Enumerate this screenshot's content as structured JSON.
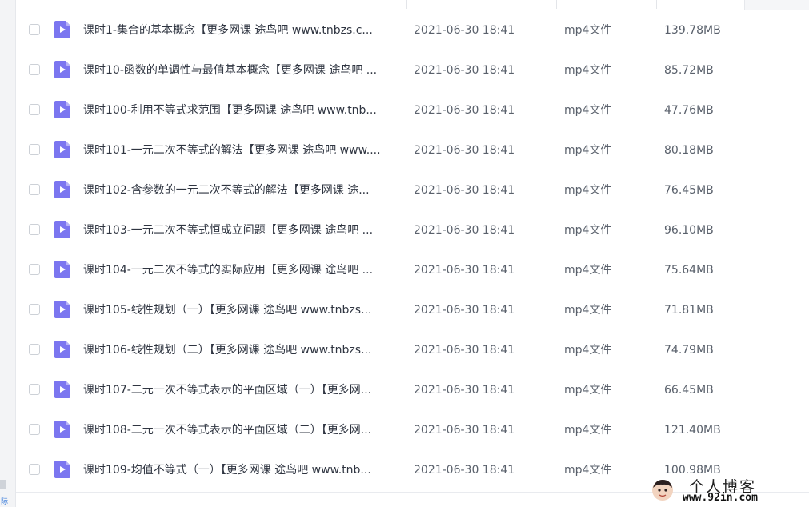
{
  "header": {
    "name_col": "",
    "date_col": "",
    "type_col": "",
    "size_col": ""
  },
  "colors": {
    "icon_bg": "#7b76f0",
    "icon_fold": "#b7b3f8",
    "side_glyph": "#3b7ddb"
  },
  "left_panel": {
    "edge_glyph": "际"
  },
  "files": [
    {
      "name": "课时1-集合的基本概念【更多网课 途鸟吧 www.tnbzs.c...",
      "date": "2021-06-30 18:41",
      "type": "mp4文件",
      "size": "139.78MB",
      "icon": "video-file-icon"
    },
    {
      "name": "课时10-函数的单调性与最值基本概念【更多网课 途鸟吧 ...",
      "date": "2021-06-30 18:41",
      "type": "mp4文件",
      "size": "85.72MB",
      "icon": "video-file-icon"
    },
    {
      "name": "课时100-利用不等式求范围【更多网课 途鸟吧 www.tnb...",
      "date": "2021-06-30 18:41",
      "type": "mp4文件",
      "size": "47.76MB",
      "icon": "video-file-icon"
    },
    {
      "name": "课时101-一元二次不等式的解法【更多网课 途鸟吧 www....",
      "date": "2021-06-30 18:41",
      "type": "mp4文件",
      "size": "80.18MB",
      "icon": "video-file-icon"
    },
    {
      "name": "课时102-含参数的一元二次不等式的解法【更多网课 途...",
      "date": "2021-06-30 18:41",
      "type": "mp4文件",
      "size": "76.45MB",
      "icon": "video-file-icon"
    },
    {
      "name": "课时103-一元二次不等式恒成立问题【更多网课 途鸟吧 ...",
      "date": "2021-06-30 18:41",
      "type": "mp4文件",
      "size": "96.10MB",
      "icon": "video-file-icon"
    },
    {
      "name": "课时104-一元二次不等式的实际应用【更多网课 途鸟吧 ...",
      "date": "2021-06-30 18:41",
      "type": "mp4文件",
      "size": "75.64MB",
      "icon": "video-file-icon"
    },
    {
      "name": "课时105-线性规划（一）【更多网课 途鸟吧 www.tnbzs...",
      "date": "2021-06-30 18:41",
      "type": "mp4文件",
      "size": "71.81MB",
      "icon": "video-file-icon"
    },
    {
      "name": "课时106-线性规划（二）【更多网课 途鸟吧 www.tnbzs...",
      "date": "2021-06-30 18:41",
      "type": "mp4文件",
      "size": "74.79MB",
      "icon": "video-file-icon"
    },
    {
      "name": "课时107-二元一次不等式表示的平面区域（一）【更多网...",
      "date": "2021-06-30 18:41",
      "type": "mp4文件",
      "size": "66.45MB",
      "icon": "video-file-icon"
    },
    {
      "name": "课时108-二元一次不等式表示的平面区域（二）【更多网...",
      "date": "2021-06-30 18:41",
      "type": "mp4文件",
      "size": "121.40MB",
      "icon": "video-file-icon"
    },
    {
      "name": "课时109-均值不等式（一）【更多网课 途鸟吧 www.tnb...",
      "date": "2021-06-30 18:41",
      "type": "mp4文件",
      "size": "100.98MB",
      "icon": "video-file-icon"
    }
  ],
  "watermark": {
    "title": "个人博客",
    "url": "www.92in.com"
  }
}
